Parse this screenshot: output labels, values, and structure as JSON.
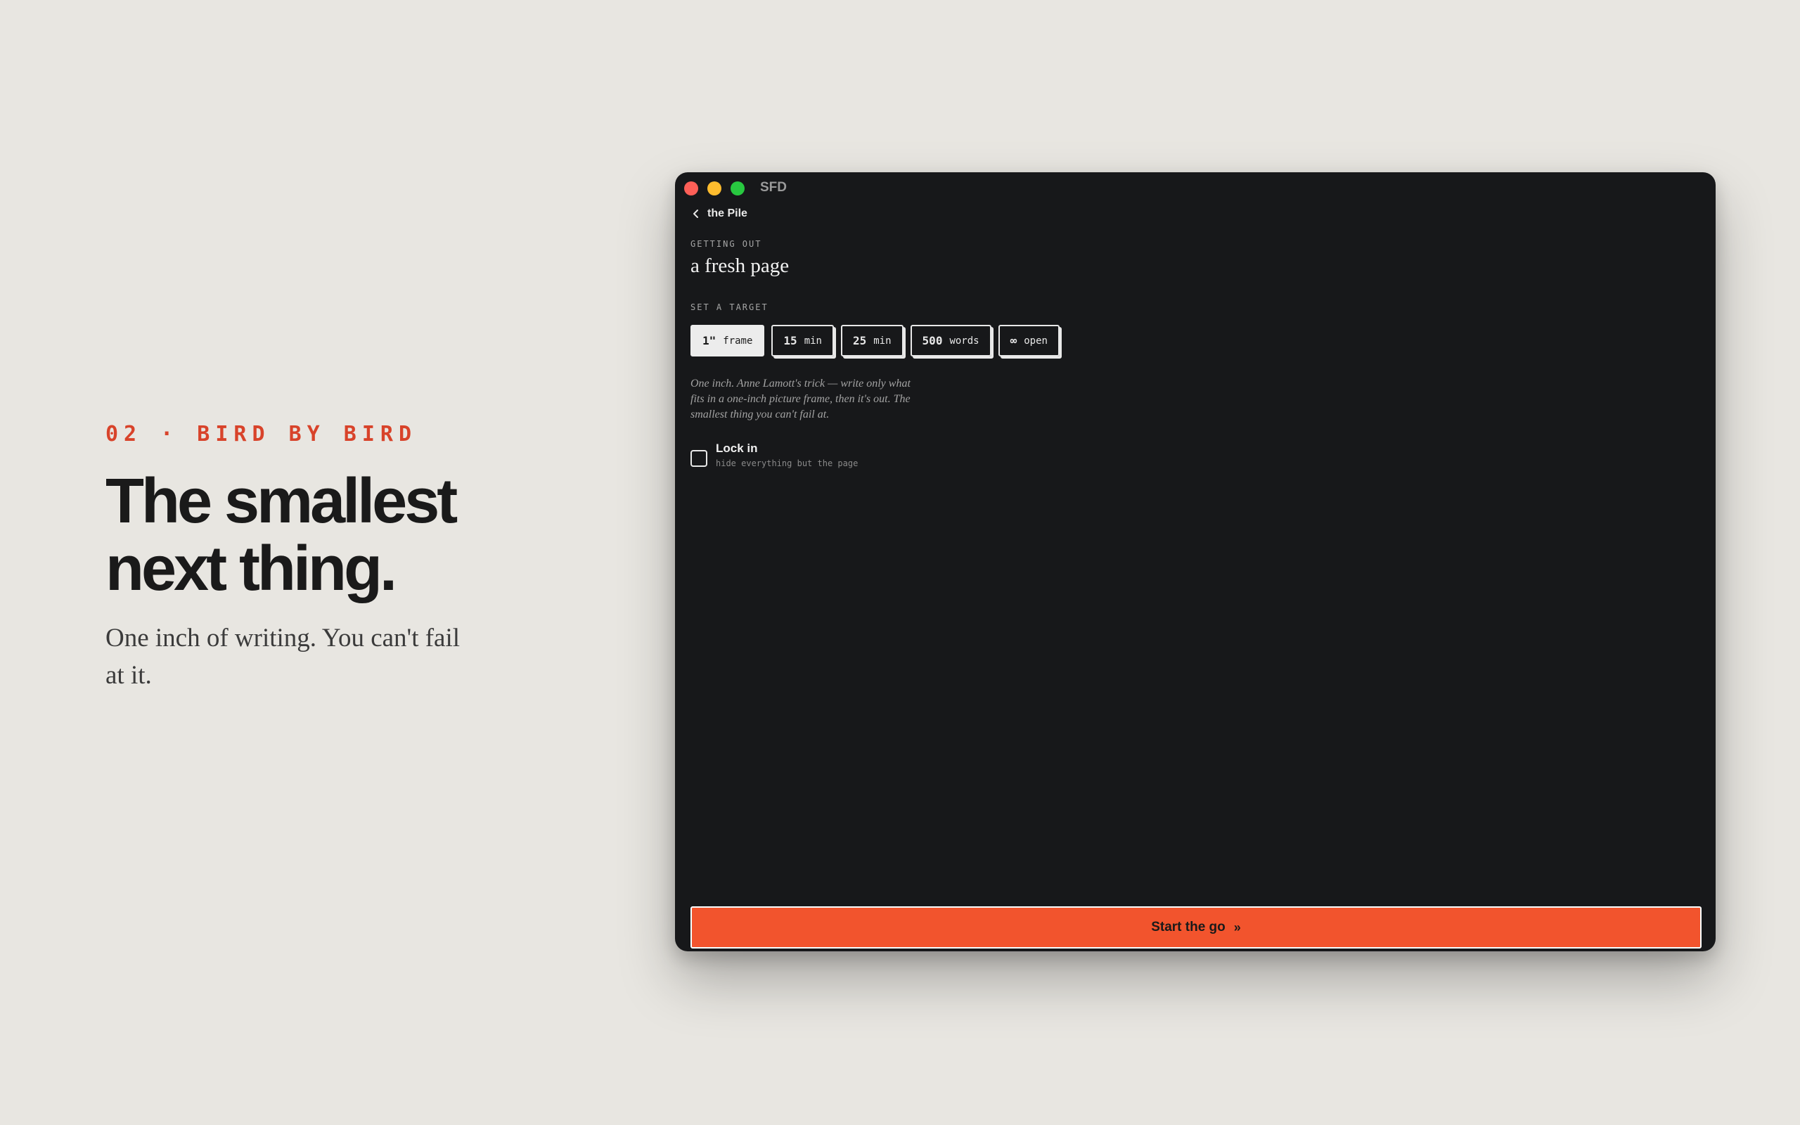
{
  "hero": {
    "eyebrow": "02 · BIRD BY BIRD",
    "headline_line1": "The smallest",
    "headline_line2": "next thing.",
    "subhead": "One inch of writing. You can't fail at it."
  },
  "window": {
    "title": "SFD",
    "back_label": "the Pile",
    "section_getting_out": "GETTING OUT",
    "doc_title": "a fresh page",
    "section_target": "SET A TARGET",
    "targets": [
      {
        "value": "1\"",
        "unit": "frame",
        "selected": true
      },
      {
        "value": "15",
        "unit": "min",
        "selected": false
      },
      {
        "value": "25",
        "unit": "min",
        "selected": false
      },
      {
        "value": "500",
        "unit": "words",
        "selected": false
      },
      {
        "value": "∞",
        "unit": "open",
        "selected": false
      }
    ],
    "description": "One inch. Anne Lamott's trick — write only what fits in a one-inch picture frame, then it's out. The smallest thing you can't fail at.",
    "lock": {
      "title": "Lock in",
      "subtitle": "hide everything but the page",
      "checked": false
    },
    "start_label": "Start the go",
    "start_icon": "»"
  },
  "colors": {
    "accent": "#f2542d",
    "eyebrow": "#d8432a",
    "window_bg": "#17181a",
    "page_bg": "#e8e6e1"
  }
}
